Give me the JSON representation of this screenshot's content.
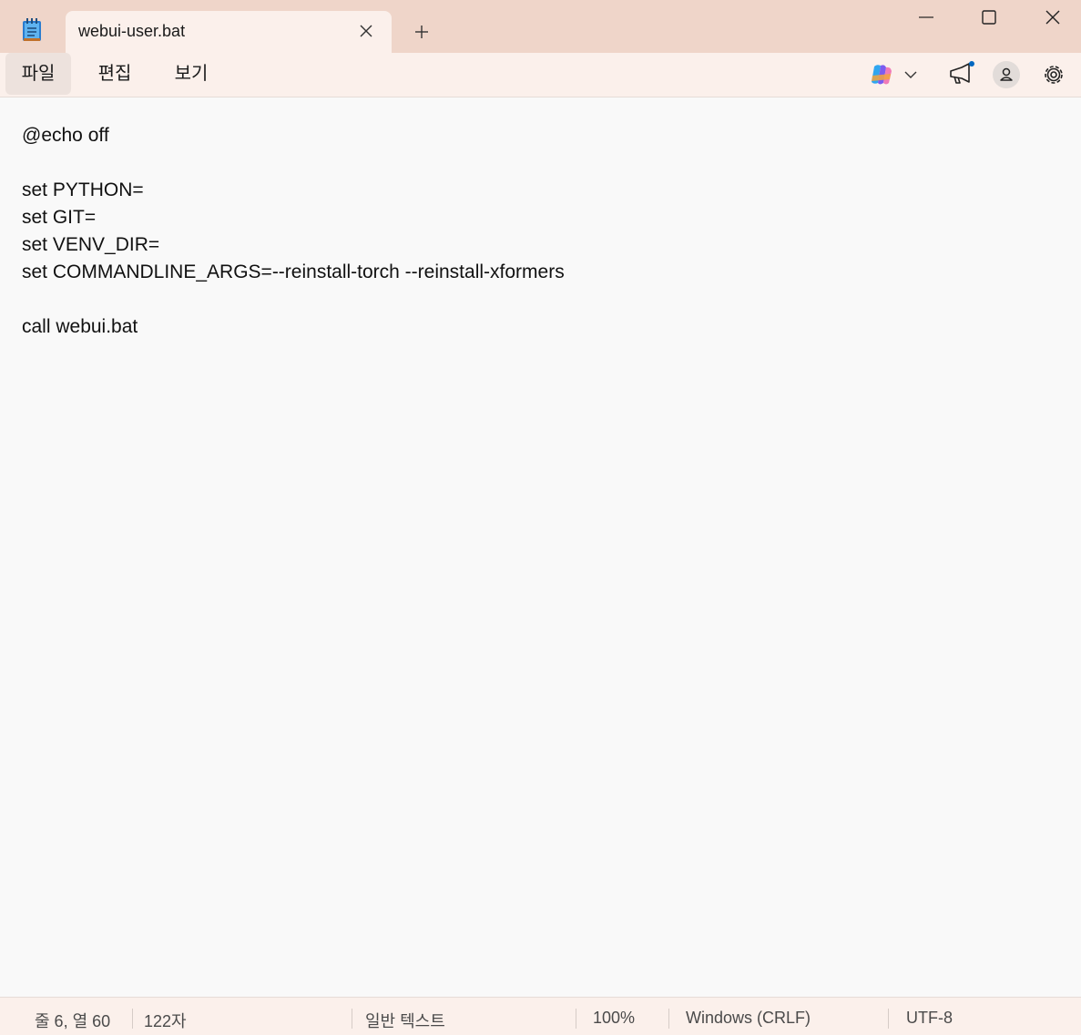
{
  "tab": {
    "title": "webui-user.bat"
  },
  "icons": {
    "app": "notepad-icon",
    "close_tab": "close-icon",
    "new_tab": "plus-icon",
    "minimize": "minimize-icon",
    "maximize": "maximize-icon",
    "close_window": "close-icon",
    "copilot": "copilot-icon",
    "copilot_dropdown": "chevron-down-icon",
    "announcement": "megaphone-icon",
    "account": "account-icon",
    "settings": "gear-icon"
  },
  "menu": {
    "file": "파일",
    "edit": "편집",
    "view": "보기"
  },
  "editor": {
    "lines": [
      "@echo off",
      "",
      "set PYTHON=",
      "set GIT=",
      "set VENV_DIR=",
      "set COMMANDLINE_ARGS=--reinstall-torch --reinstall-xformers",
      "",
      "call webui.bat"
    ]
  },
  "status": {
    "position": "줄 6, 열 60",
    "char_count": "122자",
    "file_type": "일반 텍스트",
    "zoom": "100%",
    "line_ending": "Windows (CRLF)",
    "encoding": "UTF-8"
  },
  "colors": {
    "titlebar": "#efd5c9",
    "menubar": "#fbf0eb",
    "editor_bg": "#f9f9f9",
    "notification_dot": "#0067c0"
  }
}
